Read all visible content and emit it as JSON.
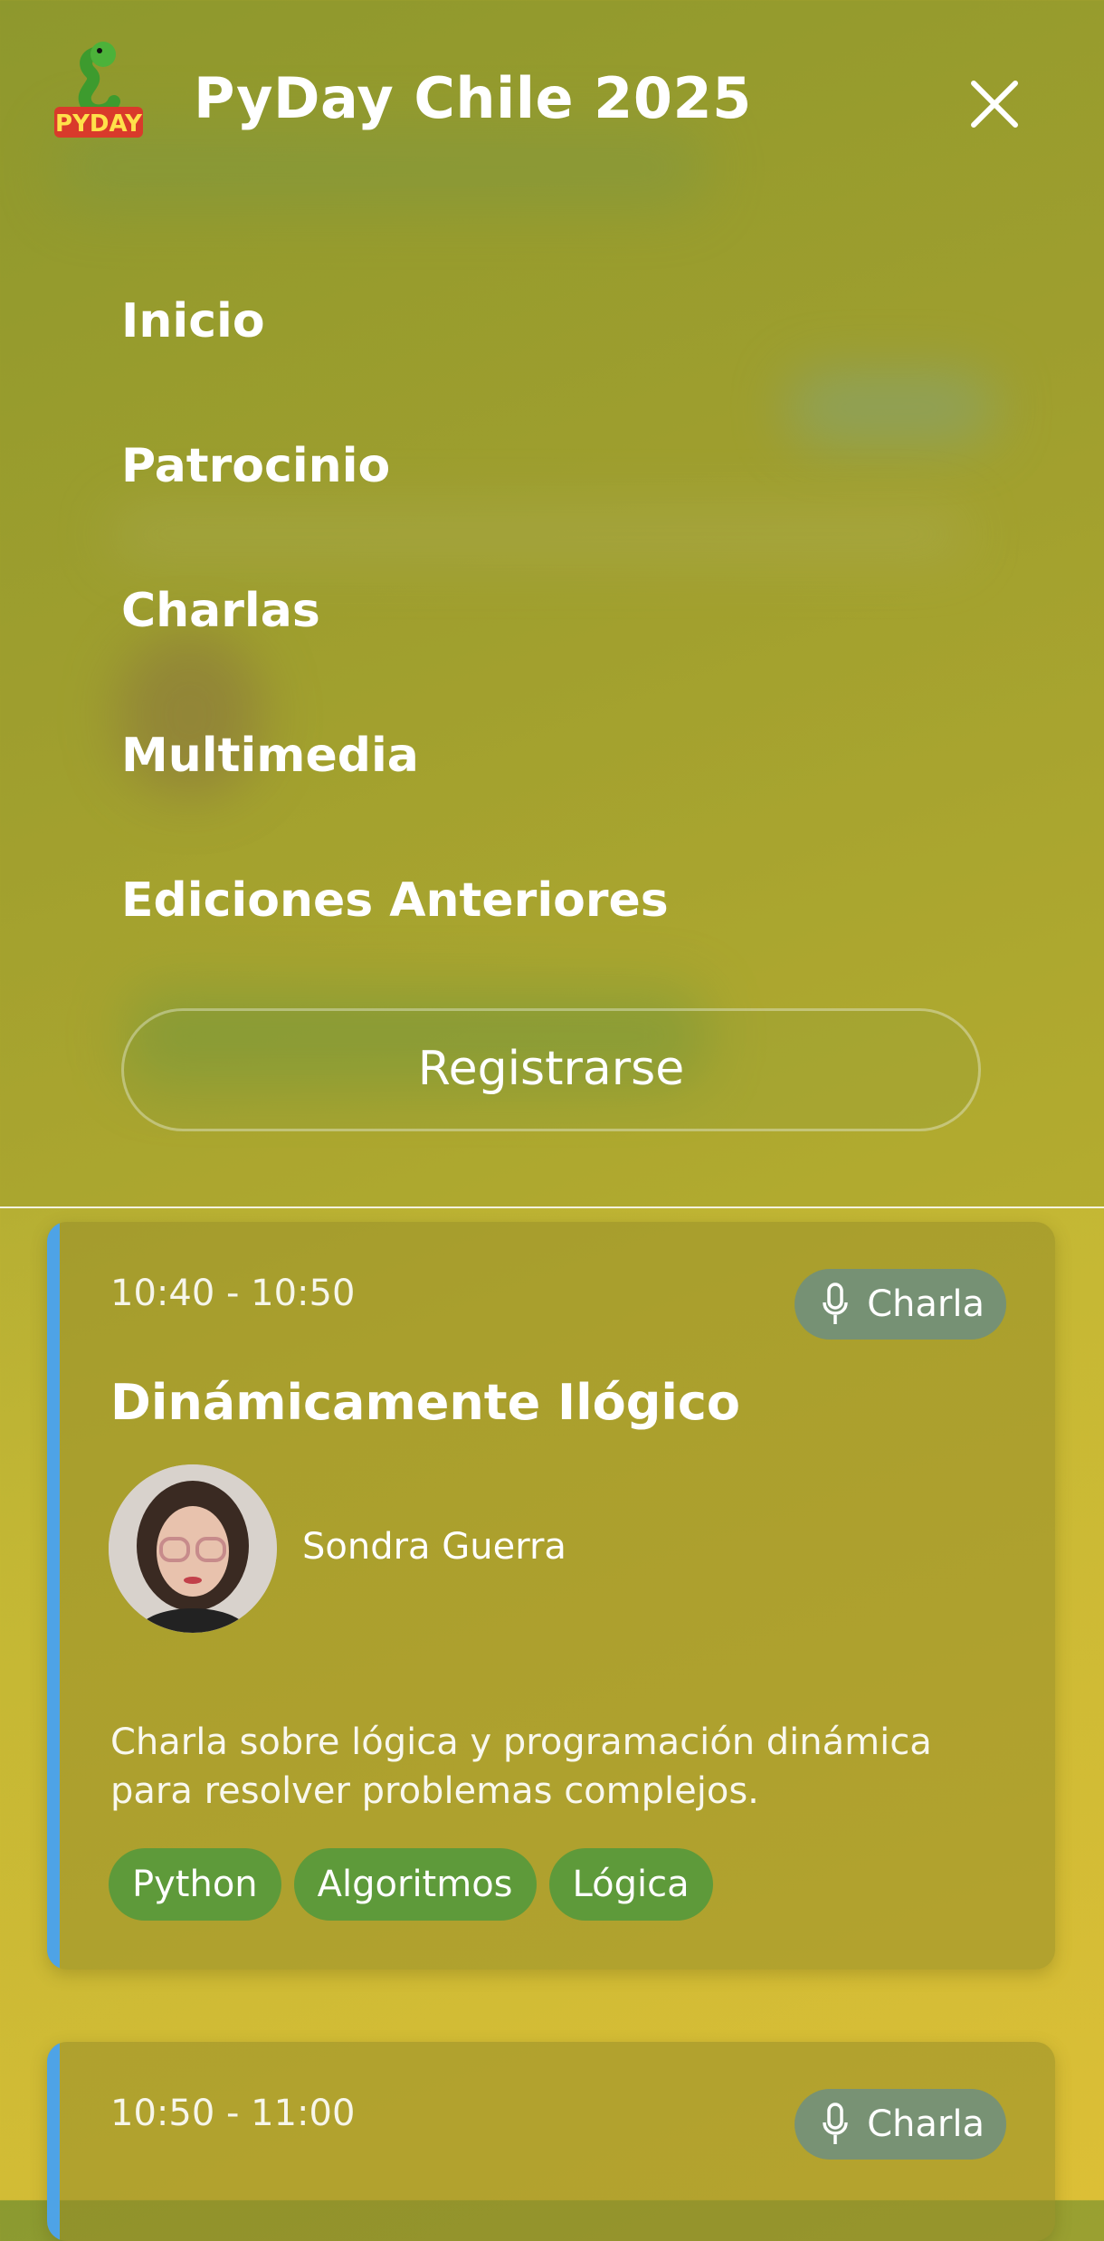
{
  "header": {
    "title": "PyDay Chile 2025",
    "logo_text": "PYDAY"
  },
  "nav": {
    "items": [
      "Inicio",
      "Patrocinio",
      "Charlas",
      "Multimedia",
      "Ediciones Anteriores"
    ],
    "register_label": "Registrarse"
  },
  "talks": [
    {
      "time": "10:40 - 10:50",
      "badge": "Charla",
      "title": "Dinámicamente Ilógico",
      "speaker": "Sondra Guerra",
      "description": "Charla sobre lógica y programación dinámica para resolver problemas complejos.",
      "tags": [
        "Python",
        "Algoritmos",
        "Lógica"
      ]
    },
    {
      "time": "10:50 - 11:00",
      "badge": "Charla"
    }
  ],
  "colors": {
    "accent_bar": "#4ea3e6",
    "tag_bg": "#5e9a3a",
    "badge_bg": "#648c8c"
  },
  "icons": {
    "close": "close-icon",
    "badge": "microphone-icon",
    "logo": "snake-logo-icon"
  }
}
